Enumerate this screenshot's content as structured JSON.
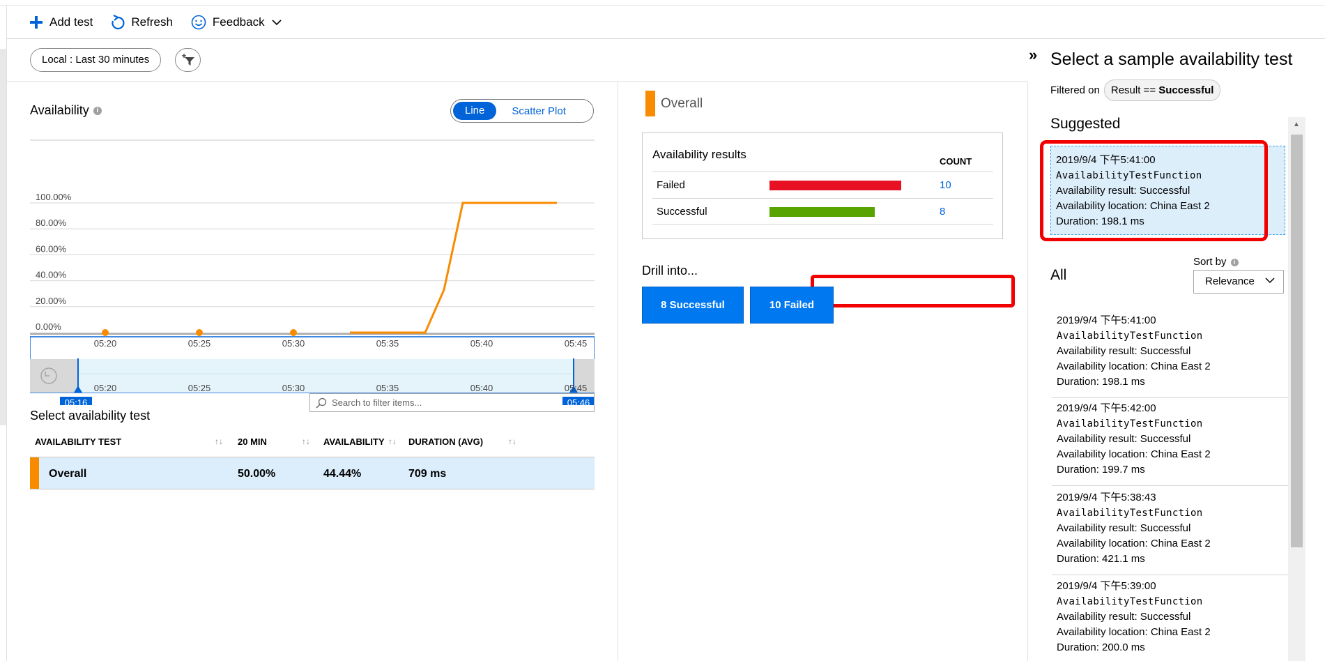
{
  "toolbar": {
    "add_test": "Add test",
    "refresh": "Refresh",
    "feedback": "Feedback"
  },
  "filter": {
    "time_range": "Local : Last 30 minutes"
  },
  "availability": {
    "title": "Availability",
    "toggle_line": "Line",
    "toggle_scatter": "Scatter Plot"
  },
  "chart_data": {
    "type": "line",
    "y_tick_labels": [
      "100.00%",
      "80.00%",
      "60.00%",
      "40.00%",
      "20.00%",
      "0.00%"
    ],
    "ylim": [
      0,
      100
    ],
    "x_tick_labels": [
      "05:20",
      "05:25",
      "05:30",
      "05:35",
      "05:40",
      "05:45"
    ],
    "x_range_minutes": [
      "05:16",
      "05:46"
    ],
    "series": [
      {
        "color": "#f98b00",
        "points": [
          {
            "x": "05:33",
            "y": 0
          },
          {
            "x": "05:37",
            "y": 0
          },
          {
            "x": "05:38",
            "y": 33
          },
          {
            "x": "05:39",
            "y": 100
          },
          {
            "x": "05:44",
            "y": 100
          }
        ],
        "dots": [
          {
            "x": "05:20",
            "y": 0
          },
          {
            "x": "05:25",
            "y": 0
          },
          {
            "x": "05:30",
            "y": 0
          }
        ]
      }
    ],
    "brush": {
      "start_label": "05:16",
      "end_label": "05:46",
      "tick_labels": [
        "05:20",
        "05:25",
        "05:30",
        "05:35",
        "05:40",
        "05:45"
      ]
    }
  },
  "select_test": {
    "title": "Select availability test",
    "search_placeholder": "Search to filter items...",
    "columns": [
      "AVAILABILITY TEST",
      "20 MIN",
      "AVAILABILITY",
      "DURATION (AVG)"
    ],
    "rows": [
      {
        "name": "Overall",
        "min20": "50.00%",
        "availability": "44.44%",
        "duration": "709 ms",
        "color": "#f98b00"
      }
    ]
  },
  "middle": {
    "legend": "Overall",
    "results_title": "Availability results",
    "count_header": "COUNT",
    "results": [
      {
        "label": "Failed",
        "count": "10",
        "fraction": 1.0,
        "color": "#e81123"
      },
      {
        "label": "Successful",
        "count": "8",
        "fraction": 0.8,
        "color": "#57a300"
      }
    ],
    "drill_title": "Drill into...",
    "drill_success": "8 Successful",
    "drill_failed": "10 Failed"
  },
  "right": {
    "title": "Select a sample availability test",
    "filtered_on": "Filtered on",
    "chip_prefix": "Result == ",
    "chip_value": "Successful",
    "suggested_title": "Suggested",
    "all_title": "All",
    "sort_label": "Sort by",
    "sort_value": "Relevance",
    "result_label": "Availability result:",
    "location_label": "Availability location:",
    "duration_label": "Duration:",
    "suggested": {
      "time": "2019/9/4 下午5:41:00",
      "name": "AvailabilityTestFunction",
      "result": "Successful",
      "location": "China East 2",
      "duration": "198.1 ms"
    },
    "items": [
      {
        "time": "2019/9/4 下午5:41:00",
        "name": "AvailabilityTestFunction",
        "result": "Successful",
        "location": "China East 2",
        "duration": "198.1 ms"
      },
      {
        "time": "2019/9/4 下午5:42:00",
        "name": "AvailabilityTestFunction",
        "result": "Successful",
        "location": "China East 2",
        "duration": "199.7 ms"
      },
      {
        "time": "2019/9/4 下午5:38:43",
        "name": "AvailabilityTestFunction",
        "result": "Successful",
        "location": "China East 2",
        "duration": "421.1 ms"
      },
      {
        "time": "2019/9/4 下午5:39:00",
        "name": "AvailabilityTestFunction",
        "result": "Successful",
        "location": "China East 2",
        "duration": "200.0 ms"
      }
    ]
  }
}
